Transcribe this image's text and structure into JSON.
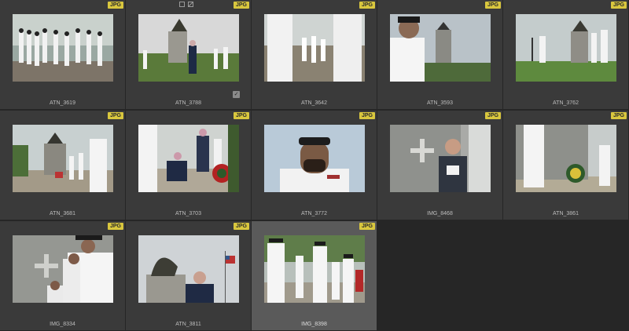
{
  "file_type_badge": "JPG",
  "thumbnails": [
    {
      "filename": "ATN_3619",
      "scene": "crowd"
    },
    {
      "filename": "ATN_3788",
      "scene": "speaker-statue",
      "check_mark": "✓",
      "show_controls": true
    },
    {
      "filename": "ATN_3642",
      "scene": "sailors-close"
    },
    {
      "filename": "ATN_3593",
      "scene": "profile-sailor"
    },
    {
      "filename": "ATN_3762",
      "scene": "statue-wide"
    },
    {
      "filename": "ATN_3681",
      "scene": "ceremony-statue"
    },
    {
      "filename": "ATN_3703",
      "scene": "wreath-kneel"
    },
    {
      "filename": "ATN_3772",
      "scene": "portrait-beret"
    },
    {
      "filename": "IMG_8468",
      "scene": "speaker-cross"
    },
    {
      "filename": "ATN_3861",
      "scene": "wreath-monument"
    },
    {
      "filename": "IMG_8334",
      "scene": "cadets-cross"
    },
    {
      "filename": "ATN_3811",
      "scene": "speaker-flag"
    },
    {
      "filename": "IMG_8398",
      "scene": "honor-guard",
      "selected": true
    }
  ]
}
